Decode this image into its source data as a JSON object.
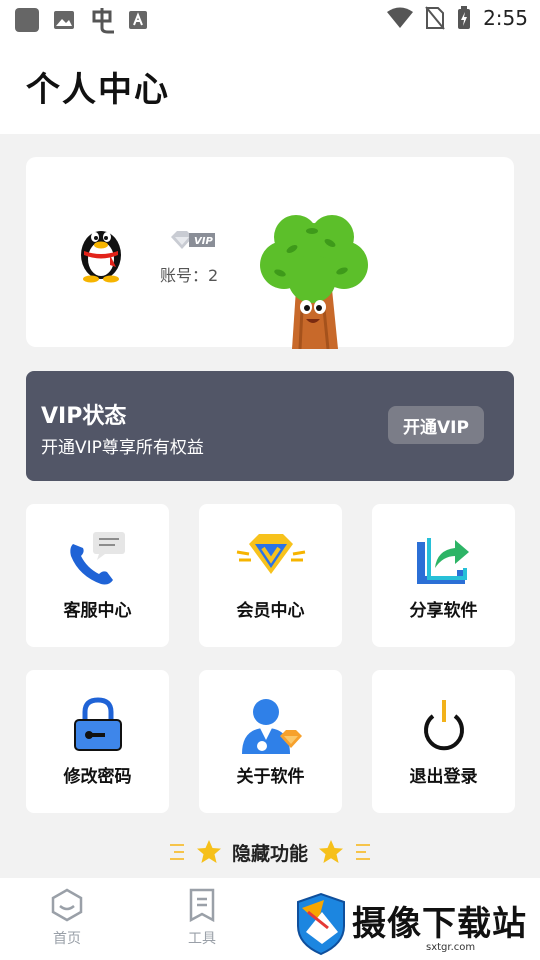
{
  "status_bar": {
    "time": "2:55",
    "left_icons": [
      "app-square-icon",
      "image-icon",
      "chinese-input-icon",
      "font-a-icon"
    ],
    "right_icons": [
      "wifi-icon",
      "no-sim-icon",
      "battery-charging-icon"
    ]
  },
  "header": {
    "title": "个人中心"
  },
  "profile": {
    "avatar_icon": "qq-penguin-icon",
    "vip_badge_text": "VIP",
    "account_label": "账号：2",
    "decoration_icon": "tree-mascot-icon"
  },
  "vip_banner": {
    "title": "VIP状态",
    "subtitle": "开通VIP尊享所有权益",
    "button_label": "开通VIP"
  },
  "grid": [
    {
      "label": "客服中心",
      "icon": "customer-service-phone-icon"
    },
    {
      "label": "会员中心",
      "icon": "vip-diamond-icon"
    },
    {
      "label": "分享软件",
      "icon": "share-icon"
    },
    {
      "label": "修改密码",
      "icon": "lock-icon"
    },
    {
      "label": "关于软件",
      "icon": "about-user-icon"
    },
    {
      "label": "退出登录",
      "icon": "power-icon"
    }
  ],
  "hidden_features": {
    "label": "隐藏功能"
  },
  "tabbar": [
    {
      "label": "首页",
      "icon": "home-hexagon-icon"
    },
    {
      "label": "工具",
      "icon": "tools-bookmark-icon"
    }
  ],
  "watermark": {
    "text": "摄像下载站",
    "url": "sxtgr.com"
  },
  "colors": {
    "vip_banner_bg": "#525667",
    "vip_button_bg": "#7b7d88",
    "page_bg": "#f2f2f2",
    "tab_inactive": "#9aa0a8"
  }
}
